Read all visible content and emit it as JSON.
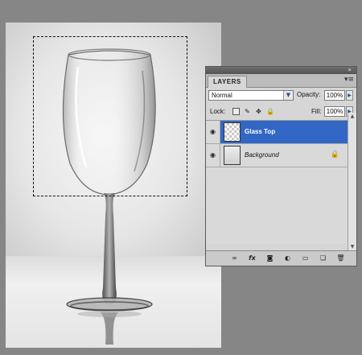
{
  "panel": {
    "tab_label": "LAYERS",
    "collapse_icon": "double-chevron-right-icon",
    "menu_icon": "panel-menu-icon",
    "blend_mode": "Normal",
    "opacity_label": "Opacity:",
    "opacity_value": "100%",
    "lock_label": "Lock:",
    "fill_label": "Fill:",
    "fill_value": "100%"
  },
  "layers": [
    {
      "name": "Glass Top",
      "visible": true,
      "selected": true,
      "locked": false
    },
    {
      "name": "Background",
      "visible": true,
      "selected": false,
      "locked": true
    }
  ],
  "footer_icons": [
    "link-layers-icon",
    "fx-icon",
    "layer-mask-icon",
    "adjustment-layer-icon",
    "new-group-icon",
    "new-layer-icon",
    "trash-icon"
  ],
  "colors": {
    "selection": "#3267c5",
    "panel_bg": "#d6d6d6",
    "workspace": "#868686"
  }
}
